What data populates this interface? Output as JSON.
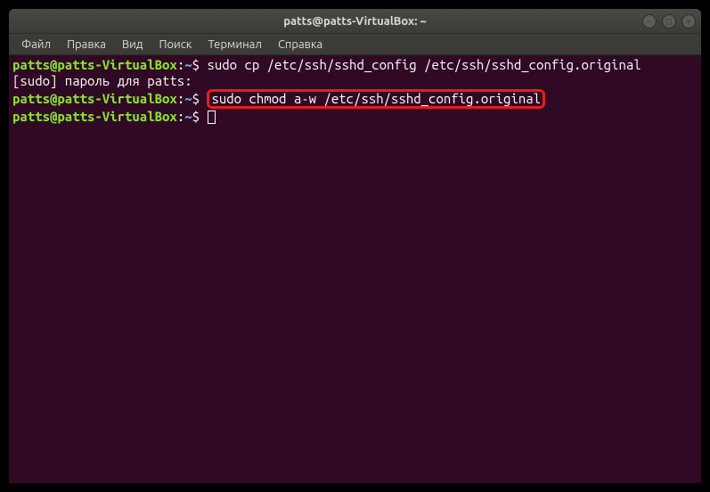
{
  "window": {
    "title": "patts@patts-VirtualBox: ~"
  },
  "menubar": {
    "items": [
      "Файл",
      "Правка",
      "Вид",
      "Поиск",
      "Терминал",
      "Справка"
    ]
  },
  "terminal": {
    "prompt": {
      "user_host": "patts@patts-VirtualBox",
      "separator": ":",
      "path": "~",
      "symbol": "$"
    },
    "lines": [
      {
        "type": "command",
        "text": "sudo cp /etc/ssh/sshd_config /etc/ssh/sshd_config.original"
      },
      {
        "type": "output",
        "text": "[sudo] пароль для patts:"
      },
      {
        "type": "command_highlighted",
        "text": "sudo chmod a-w /etc/ssh/sshd_config.original"
      },
      {
        "type": "prompt_cursor"
      }
    ]
  },
  "window_controls": {
    "minimize": "−",
    "maximize": "□",
    "close": "×"
  }
}
